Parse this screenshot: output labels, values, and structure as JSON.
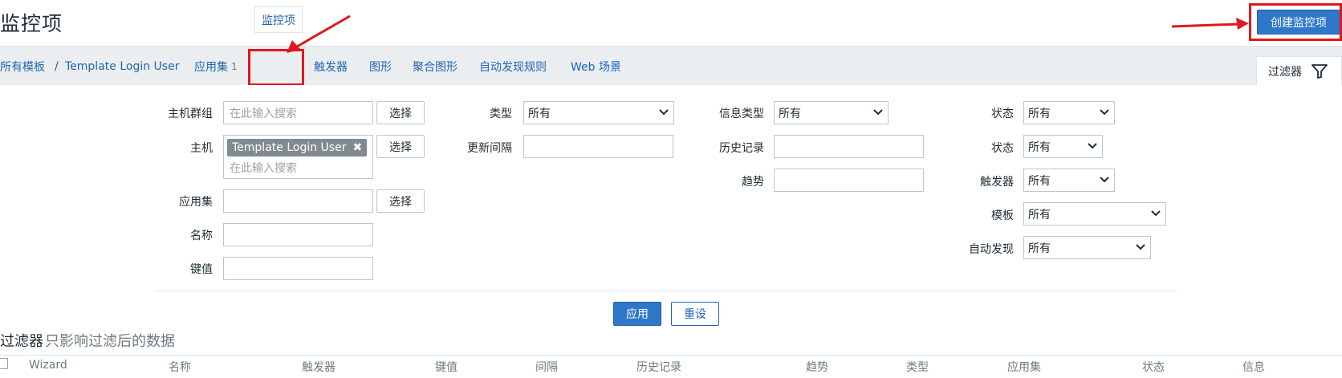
{
  "page": {
    "title": "监控项"
  },
  "header": {
    "create_button": "创建监控项"
  },
  "breadcrumb": {
    "all_templates": "所有模板",
    "separator": "/",
    "template": "Template Login User"
  },
  "tabs": [
    {
      "label": "应用集",
      "count": "1"
    },
    {
      "label": "监控项"
    },
    {
      "label": "触发器"
    },
    {
      "label": "图形"
    },
    {
      "label": "聚合图形"
    },
    {
      "label": "自动发现规则"
    },
    {
      "label": "Web 场景"
    }
  ],
  "filter_tab": {
    "label": "过滤器",
    "icon": "filter-icon"
  },
  "filter": {
    "host_group": {
      "label": "主机群组",
      "placeholder": "在此输入搜索",
      "button": "选择"
    },
    "host": {
      "label": "主机",
      "tag": "Template Login User",
      "placeholder": "在此输入搜索",
      "button": "选择"
    },
    "application": {
      "label": "应用集",
      "button": "选择"
    },
    "name": {
      "label": "名称"
    },
    "key": {
      "label": "键值"
    },
    "type": {
      "label": "类型",
      "value": "所有"
    },
    "update_interval": {
      "label": "更新间隔"
    },
    "info_type": {
      "label": "信息类型",
      "value": "所有"
    },
    "history": {
      "label": "历史记录"
    },
    "trends": {
      "label": "趋势"
    },
    "state": {
      "label": "状态",
      "value": "所有"
    },
    "status": {
      "label": "状态",
      "value": "所有"
    },
    "triggers": {
      "label": "触发器",
      "value": "所有"
    },
    "template": {
      "label": "模板",
      "value": "所有"
    },
    "discovery": {
      "label": "自动发现",
      "value": "所有"
    },
    "apply_button": "应用",
    "reset_button": "重设"
  },
  "subfilter": {
    "title": "过滤器",
    "hint": "只影响过滤后的数据"
  },
  "table": {
    "columns": [
      "Wizard",
      "名称",
      "触发器",
      "键值",
      "间隔",
      "历史记录",
      "趋势",
      "类型",
      "应用集",
      "状态",
      "信息"
    ]
  },
  "colors": {
    "accent": "#2f77c9",
    "link": "#1f65b6",
    "annotation": "#e0181f",
    "nav_bg": "#ebeef0"
  }
}
